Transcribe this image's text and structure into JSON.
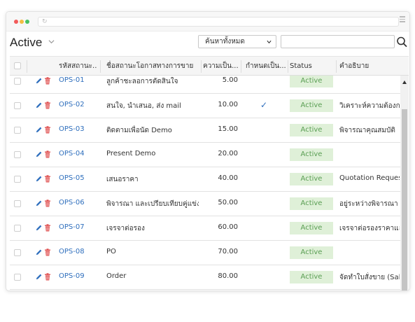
{
  "toolbar": {
    "view_title": "Active",
    "filter_select": "ค้นหาทั้งหมด",
    "search_value": ""
  },
  "columns": [
    "รหัสสถานะ...",
    "ชื่อสถานะโอกาสทางการขาย",
    "ความเป็น...",
    "กำหนดเป็น...",
    "Status",
    "คำอธิบาย"
  ],
  "rows": [
    {
      "code": "OPS-01",
      "name": "ลูกค้าชะลอการตัดสินใจ",
      "value": "5.00",
      "default": "",
      "status": "Active",
      "desc": ""
    },
    {
      "code": "OPS-02",
      "name": "สนใจ, นำเสนอ, ส่ง mail",
      "value": "10.00",
      "default": "✓",
      "status": "Active",
      "desc": "วิเคราะห์ความต้องการ"
    },
    {
      "code": "OPS-03",
      "name": "ติดตามเพื่อนัด Demo",
      "value": "15.00",
      "default": "",
      "status": "Active",
      "desc": "พิจารณาคุณสมบัติ"
    },
    {
      "code": "OPS-04",
      "name": "Present Demo",
      "value": "20.00",
      "default": "",
      "status": "Active",
      "desc": ""
    },
    {
      "code": "OPS-05",
      "name": "เสนอราคา",
      "value": "40.00",
      "default": "",
      "status": "Active",
      "desc": "Quotation Request"
    },
    {
      "code": "OPS-06",
      "name": "พิจารณา และเปรียบเทียบคู่แข่ง",
      "value": "50.00",
      "default": "",
      "status": "Active",
      "desc": "อยู่ระหว่างพิจารณา และ"
    },
    {
      "code": "OPS-07",
      "name": "เจรจาต่อรอง",
      "value": "60.00",
      "default": "",
      "status": "Active",
      "desc": "เจรจาต่อรองราคาและเ"
    },
    {
      "code": "OPS-08",
      "name": "PO",
      "value": "70.00",
      "default": "",
      "status": "Active",
      "desc": ""
    },
    {
      "code": "OPS-09",
      "name": "Order",
      "value": "80.00",
      "default": "",
      "status": "Active",
      "desc": "จัดทำใบสั่งขาย (Sale"
    }
  ],
  "colors": {
    "link": "#2f6fbd",
    "status_bg": "#dff0d8",
    "status_text": "#5a9e53",
    "check": "#2f6fbd",
    "delete": "#e05252"
  },
  "icons": {
    "edit": "pencil-icon",
    "delete": "trash-icon",
    "search": "search-icon",
    "check": "checkmark-icon"
  }
}
